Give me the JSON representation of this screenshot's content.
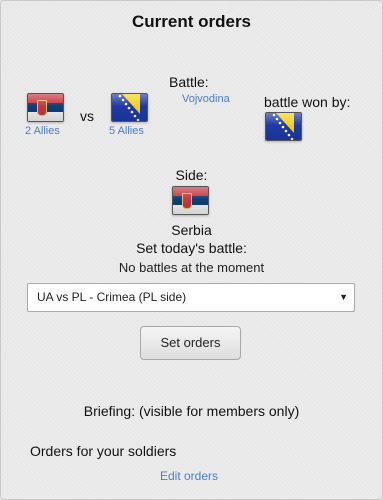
{
  "header": {
    "title": "Current orders"
  },
  "battle": {
    "label": "Battle:",
    "region": "Vojvodina",
    "won_by_label": "battle won by:",
    "vs": "vs",
    "attacker": {
      "flag": "Serbia",
      "allies": "2 Allies"
    },
    "defender": {
      "flag": "Bosnia and Herzegovina",
      "allies": "5 Allies"
    },
    "winner_flag": "Bosnia and Herzegovina"
  },
  "side": {
    "label": "Side:",
    "country": "Serbia"
  },
  "todays_battle": {
    "label": "Set today's battle:",
    "status": "No battles at the moment",
    "select_value": "UA vs PL - Crimea (PL side)",
    "button_label": "Set orders"
  },
  "briefing": {
    "label": "Briefing: (visible for members only)",
    "orders_text": "Orders for your soldiers",
    "edit_link": "Edit orders"
  },
  "colors": {
    "link": "#4a7ec6",
    "serbia_red": "#c7363d",
    "serbia_blue": "#0c4076",
    "bosnia_blue": "#1f3aa6",
    "bosnia_yellow": "#f7d116"
  }
}
